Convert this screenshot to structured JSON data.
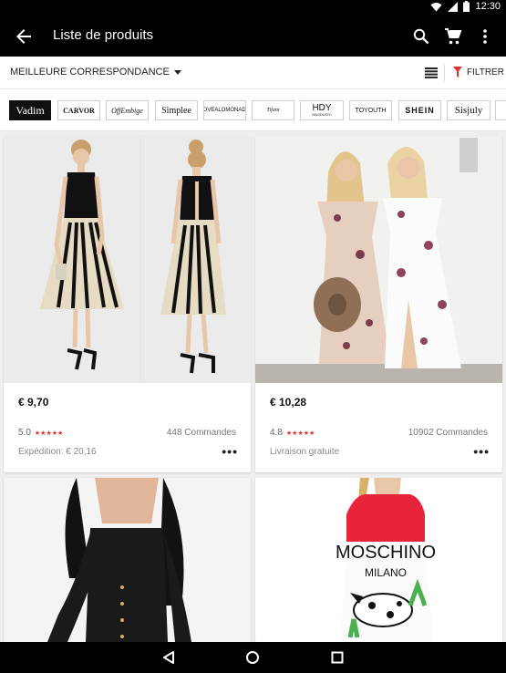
{
  "status_bar": {
    "time": "12:30",
    "icons": [
      "wifi-icon",
      "signal-icon",
      "battery-icon"
    ]
  },
  "app_bar": {
    "title": "Liste de produits",
    "icons": [
      "back-arrow-icon",
      "search-icon",
      "cart-icon",
      "more-vert-icon"
    ]
  },
  "sort_bar": {
    "sort_label": "MEILLEURE CORRESPONDANCE",
    "filter_label": "FILTRER",
    "accent": "#e12e2e"
  },
  "brands": [
    "Vadim",
    "CARVOR",
    "OffEmbige",
    "Simplee",
    "LOVEALOMONADE",
    "Tifani",
    "HDY",
    "HAODUOYI",
    "TOYOUTH",
    "SHEIN",
    "Sisjuly"
  ],
  "products": [
    {
      "price": "€ 9,70",
      "rating": "5.0",
      "orders": "448 Commandes",
      "shipping": "Expédition: € 20,16",
      "more": "•••"
    },
    {
      "price": "€ 10,28",
      "rating": "4.8",
      "orders": "10902 Commandes",
      "shipping": "Livraison gratuite",
      "more": "•••"
    },
    {
      "picture_text": [
        "MOSCHINO",
        "MILANO"
      ]
    }
  ],
  "rating_stars": "★★★★★",
  "nav_bar": {
    "icons": [
      "back-triangle-icon",
      "home-circle-icon",
      "recents-square-icon"
    ]
  }
}
